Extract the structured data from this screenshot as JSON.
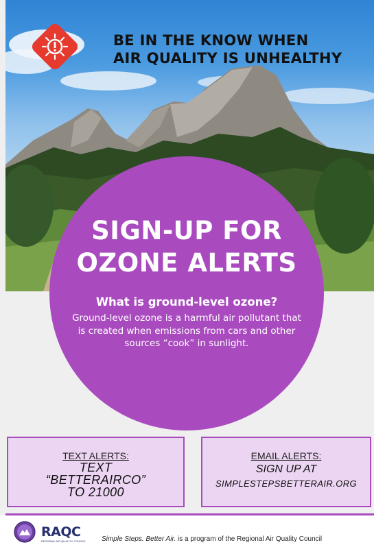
{
  "colors": {
    "brand_purple": "#a94bbf",
    "box_fill": "#ecd5f2",
    "alert_red": "#e63a2e",
    "logo_navy": "#27306e"
  },
  "headline": {
    "line1": "BE IN THE KNOW WHEN",
    "line2": "AIR QUALITY IS UNHEALTHY"
  },
  "circle": {
    "title_line1": "SIGN-UP FOR",
    "title_line2": "OZONE ALERTS",
    "question": "What is ground-level ozone?",
    "answer": "Ground-level ozone is a harmful air pollutant that is created when emissions from cars and other sources “cook” in sunlight."
  },
  "text_alerts": {
    "label": "TEXT ALERTS:",
    "line1": "TEXT",
    "line2": "“BETTERAIRCO”",
    "line3": "TO 21000"
  },
  "email_alerts": {
    "label": "EMAIL ALERTS:",
    "line1": "SIGN UP AT",
    "url": "SIMPLESTEPSBETTERAIR.ORG"
  },
  "footer": {
    "logo_text": "RAQC",
    "logo_subtext": "REGIONAL AIR QUALITY COUNCIL",
    "tagline_italic": "Simple Steps. Better Air.",
    "tagline_rest": " is a program of the Regional Air Quality Council"
  },
  "icons": {
    "alert": "sun-warning-icon",
    "seal": "simple-steps-seal-icon"
  }
}
